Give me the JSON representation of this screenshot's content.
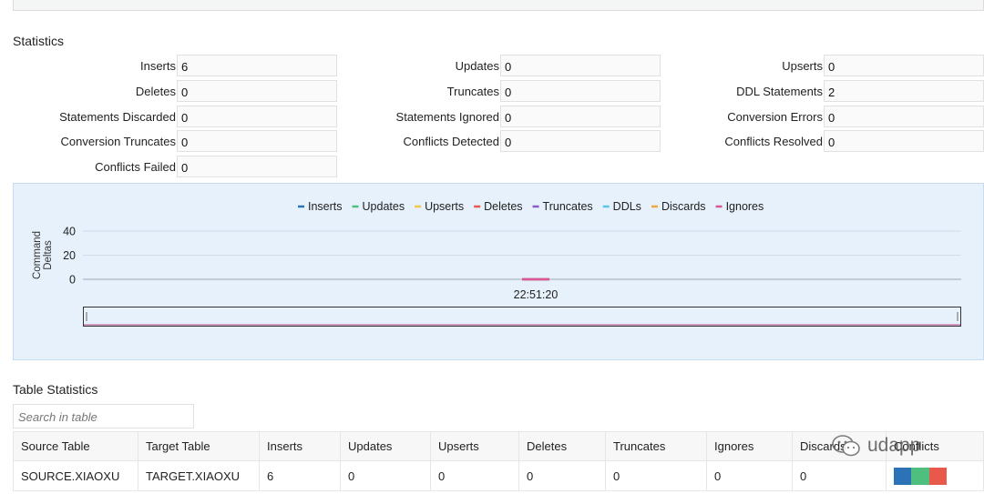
{
  "statistics": {
    "title": "Statistics",
    "fields": [
      {
        "label": "Inserts",
        "value": "6"
      },
      {
        "label": "Updates",
        "value": "0"
      },
      {
        "label": "Upserts",
        "value": "0"
      },
      {
        "label": "Deletes",
        "value": "0"
      },
      {
        "label": "Truncates",
        "value": "0"
      },
      {
        "label": "DDL Statements",
        "value": "2"
      },
      {
        "label": "Statements Discarded",
        "value": "0"
      },
      {
        "label": "Statements Ignored",
        "value": "0"
      },
      {
        "label": "Conversion Errors",
        "value": "0"
      },
      {
        "label": "Conversion Truncates",
        "value": "0"
      },
      {
        "label": "Conflicts Detected",
        "value": "0"
      },
      {
        "label": "Conflicts Resolved",
        "value": "0"
      },
      {
        "label": "Conflicts Failed",
        "value": "0"
      }
    ]
  },
  "chart_data": {
    "type": "line",
    "title": "",
    "ylabel": "Command Deltas",
    "xlabel": "",
    "yticks": [
      0,
      20,
      40
    ],
    "ylim": [
      0,
      40
    ],
    "x": [
      "22:51:20"
    ],
    "legend_position": "top-center",
    "grid": true,
    "series": [
      {
        "name": "Inserts",
        "color": "#2b73b6",
        "values": [
          0
        ]
      },
      {
        "name": "Updates",
        "color": "#4fbf7f",
        "values": [
          0
        ]
      },
      {
        "name": "Upserts",
        "color": "#f1c64a",
        "values": [
          0
        ]
      },
      {
        "name": "Deletes",
        "color": "#e8594b",
        "values": [
          0
        ]
      },
      {
        "name": "Truncates",
        "color": "#8a5bc7",
        "values": [
          0
        ]
      },
      {
        "name": "DDLs",
        "color": "#5cc6e6",
        "values": [
          0
        ]
      },
      {
        "name": "Discards",
        "color": "#f2a541",
        "values": [
          0
        ]
      },
      {
        "name": "Ignores",
        "color": "#d9579a",
        "values": [
          0
        ]
      }
    ]
  },
  "table_statistics": {
    "title": "Table Statistics",
    "search_placeholder": "Search in table",
    "columns": [
      "Source Table",
      "Target Table",
      "Inserts",
      "Updates",
      "Upserts",
      "Deletes",
      "Truncates",
      "Ignores",
      "Discards",
      "Conflicts"
    ],
    "rows": [
      {
        "cells": [
          "SOURCE.XIAOXU",
          "TARGET.XIAOXU",
          "6",
          "0",
          "0",
          "0",
          "0",
          "0",
          "0"
        ],
        "conflict_bar_colors": [
          "#2b73b6",
          "#4fbf7f",
          "#e8594b"
        ]
      }
    ]
  },
  "watermark": {
    "text": "udapp",
    "icon": "wechat-icon"
  }
}
